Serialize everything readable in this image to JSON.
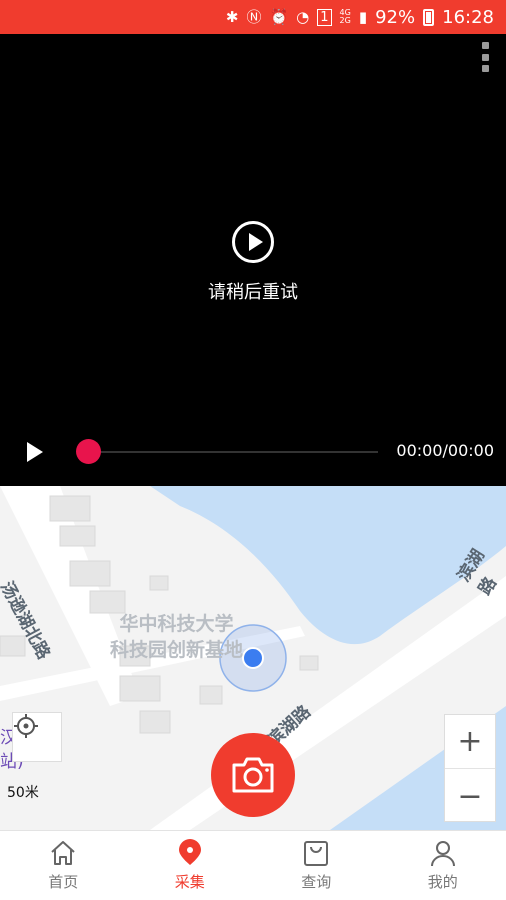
{
  "status_bar": {
    "battery": "92%",
    "time": "16:28",
    "network_top": "4G",
    "network_bottom": "2G",
    "sim_slot": "1"
  },
  "video": {
    "message": "请稍后重试",
    "time_display": "00:00/00:00",
    "progress": 0
  },
  "map": {
    "road_1": "汤逊湖北路",
    "road_2": "滨湖路",
    "road_3": "滨湖路",
    "campus_line1": "华中科技大学",
    "campus_line2": "科技园创新基地",
    "partial_label_1": "汉",
    "partial_label_2": "站)",
    "scale": "50米",
    "zoom_in": "+",
    "zoom_out": "−"
  },
  "tabs": [
    {
      "label": "首页",
      "icon": "home-icon"
    },
    {
      "label": "采集",
      "icon": "collect-icon"
    },
    {
      "label": "查询",
      "icon": "query-bag-icon"
    },
    {
      "label": "我的",
      "icon": "profile-icon"
    }
  ],
  "colors": {
    "accent": "#f03c2e",
    "progress_thumb": "#e8144c",
    "water": "#c5def7",
    "location_dot": "#3b7df0"
  }
}
